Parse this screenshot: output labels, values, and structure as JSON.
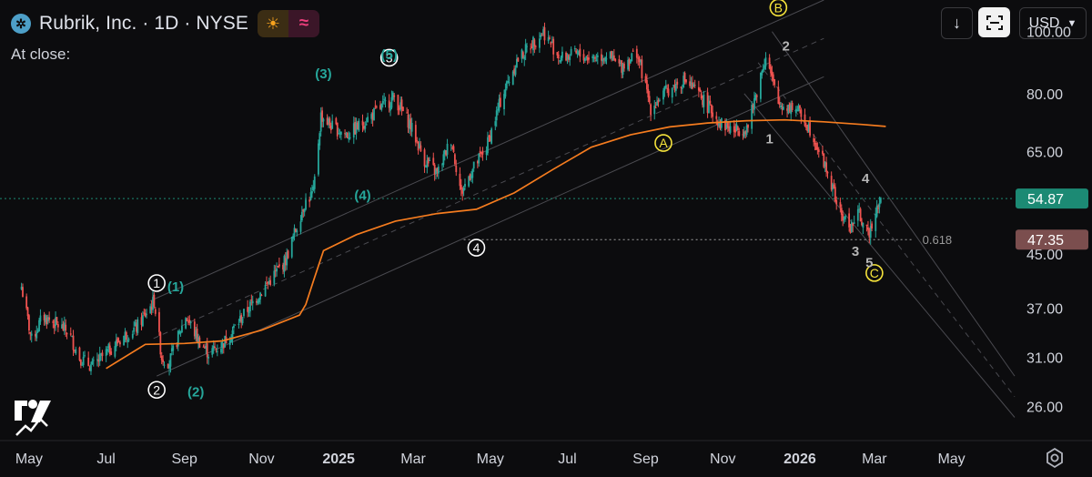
{
  "header": {
    "symbol_title": "Rubrik, Inc. · 1D · NYSE",
    "at_close_label": "At close:",
    "logo_icon": "rubrik-logo-icon",
    "session_icon": "sun-icon",
    "indicator_icon": "wave-icon"
  },
  "toolbar": {
    "currency_label": "USD",
    "download_icon": "arrow-down-icon",
    "screenshot_icon": "frame-icon"
  },
  "settings_icon": "gear-icon",
  "colors": {
    "up": "#26a69a",
    "down": "#ef5350",
    "ma": "#f57c1f",
    "last_price_bg": "#1c8a74",
    "retracement_bg": "#7b4e4e",
    "wave_major": "#ffffff",
    "wave_minor": "#26a69a",
    "wave_abc": "#f5e33b",
    "wave_sub": "#b5b5b5"
  },
  "chart_data": {
    "type": "candlestick",
    "interval": "1D",
    "exchange": "NYSE",
    "y_scale": "log",
    "ylim": [
      23,
      112
    ],
    "y_ticks": [
      26,
      31,
      37,
      45,
      55,
      65,
      80,
      100
    ],
    "y_tick_labels": [
      "26.00",
      "31.00",
      "37.00",
      "45.00",
      "55.00",
      "65.00",
      "80.00",
      "100.00"
    ],
    "x_range": [
      "2024-04-08",
      "2026-06-20"
    ],
    "x_ticks": [
      {
        "date": "2024-05-01",
        "label": "May",
        "bold": false
      },
      {
        "date": "2024-07-01",
        "label": "Jul",
        "bold": false
      },
      {
        "date": "2024-09-01",
        "label": "Sep",
        "bold": false
      },
      {
        "date": "2024-11-01",
        "label": "Nov",
        "bold": false
      },
      {
        "date": "2025-01-01",
        "label": "2025",
        "bold": true
      },
      {
        "date": "2025-03-01",
        "label": "Mar",
        "bold": false
      },
      {
        "date": "2025-05-01",
        "label": "May",
        "bold": false
      },
      {
        "date": "2025-07-01",
        "label": "Jul",
        "bold": false
      },
      {
        "date": "2025-09-01",
        "label": "Sep",
        "bold": false
      },
      {
        "date": "2025-11-01",
        "label": "Nov",
        "bold": false
      },
      {
        "date": "2026-01-01",
        "label": "2026",
        "bold": true
      },
      {
        "date": "2026-03-01",
        "label": "Mar",
        "bold": false
      },
      {
        "date": "2026-05-01",
        "label": "May",
        "bold": false
      }
    ],
    "price_path": [
      [
        "2024-04-25",
        40.0
      ],
      [
        "2024-05-03",
        33.0
      ],
      [
        "2024-05-12",
        36.0
      ],
      [
        "2024-05-22",
        35.0
      ],
      [
        "2024-06-01",
        34.0
      ],
      [
        "2024-06-10",
        31.0
      ],
      [
        "2024-06-20",
        30.0
      ],
      [
        "2024-07-01",
        31.5
      ],
      [
        "2024-07-15",
        33.5
      ],
      [
        "2024-07-25",
        34.5
      ],
      [
        "2024-08-08",
        38.0
      ],
      [
        "2024-08-14",
        31.0
      ],
      [
        "2024-08-20",
        30.5
      ],
      [
        "2024-09-02",
        36.0
      ],
      [
        "2024-09-12",
        33.0
      ],
      [
        "2024-09-20",
        31.5
      ],
      [
        "2024-10-01",
        32.5
      ],
      [
        "2024-10-15",
        35.5
      ],
      [
        "2024-10-28",
        38.5
      ],
      [
        "2024-11-08",
        41.0
      ],
      [
        "2024-11-20",
        44.0
      ],
      [
        "2024-12-05",
        54.0
      ],
      [
        "2024-12-12",
        56.0
      ],
      [
        "2024-12-18",
        74.0
      ],
      [
        "2024-12-27",
        71.0
      ],
      [
        "2025-01-08",
        69.0
      ],
      [
        "2025-01-20",
        72.0
      ],
      [
        "2025-02-03",
        76.0
      ],
      [
        "2025-02-14",
        79.0
      ],
      [
        "2025-02-26",
        72.0
      ],
      [
        "2025-03-10",
        63.0
      ],
      [
        "2025-03-20",
        60.0
      ],
      [
        "2025-03-31",
        68.0
      ],
      [
        "2025-04-08",
        56.0
      ],
      [
        "2025-04-15",
        60.0
      ],
      [
        "2025-04-28",
        66.0
      ],
      [
        "2025-05-10",
        79.0
      ],
      [
        "2025-05-22",
        90.0
      ],
      [
        "2025-06-03",
        96.0
      ],
      [
        "2025-06-12",
        100.0
      ],
      [
        "2025-06-25",
        91.0
      ],
      [
        "2025-07-08",
        92.0
      ],
      [
        "2025-07-20",
        91.0
      ],
      [
        "2025-08-01",
        92.0
      ],
      [
        "2025-08-12",
        88.0
      ],
      [
        "2025-08-25",
        93.0
      ],
      [
        "2025-09-05",
        76.0
      ],
      [
        "2025-09-18",
        81.0
      ],
      [
        "2025-10-02",
        84.0
      ],
      [
        "2025-10-15",
        79.0
      ],
      [
        "2025-10-30",
        72.0
      ],
      [
        "2025-11-10",
        70.0
      ],
      [
        "2025-11-21",
        71.0
      ],
      [
        "2025-12-05",
        92.0
      ],
      [
        "2025-12-15",
        77.0
      ],
      [
        "2025-12-29",
        76.0
      ],
      [
        "2026-01-10",
        70.0
      ],
      [
        "2026-01-22",
        61.0
      ],
      [
        "2026-02-02",
        52.0
      ],
      [
        "2026-02-10",
        49.5
      ],
      [
        "2026-02-17",
        52.0
      ],
      [
        "2026-02-24",
        48.0
      ],
      [
        "2026-03-02",
        53.0
      ],
      [
        "2026-03-06",
        54.87
      ]
    ],
    "moving_average": [
      [
        "2024-07-01",
        29.8
      ],
      [
        "2024-08-01",
        32.5
      ],
      [
        "2024-09-01",
        32.6
      ],
      [
        "2024-10-01",
        32.9
      ],
      [
        "2024-11-01",
        34.2
      ],
      [
        "2024-12-01",
        36.1
      ],
      [
        "2024-12-06",
        37.5
      ],
      [
        "2024-12-12",
        40.8
      ],
      [
        "2024-12-20",
        45.5
      ],
      [
        "2025-01-15",
        48.2
      ],
      [
        "2025-02-15",
        50.6
      ],
      [
        "2025-03-20",
        52.0
      ],
      [
        "2025-04-20",
        52.8
      ],
      [
        "2025-05-20",
        56.0
      ],
      [
        "2025-06-20",
        61.0
      ],
      [
        "2025-07-20",
        66.0
      ],
      [
        "2025-08-20",
        69.0
      ],
      [
        "2025-09-20",
        71.0
      ],
      [
        "2025-10-20",
        72.0
      ],
      [
        "2025-11-20",
        72.6
      ],
      [
        "2025-12-20",
        72.8
      ],
      [
        "2026-01-20",
        72.3
      ],
      [
        "2026-02-20",
        71.6
      ],
      [
        "2026-03-10",
        71.1
      ]
    ],
    "last_price": {
      "value": 54.87,
      "label": "54.87"
    },
    "retracement_level": {
      "value": 47.35,
      "label": "47.35",
      "ratio_label": "0.618"
    },
    "channels": [
      {
        "name": "channel-1",
        "lines": [
          [
            [
              "2024-08-05",
              38.0
            ],
            [
              "2026-01-20",
              112.0
            ]
          ],
          [
            [
              "2024-08-10",
              29.0
            ],
            [
              "2026-01-20",
              85.0
            ]
          ]
        ]
      },
      {
        "name": "channel-2",
        "lines": [
          [
            [
              "2025-11-18",
              80.0
            ],
            [
              "2026-06-20",
              25.0
            ]
          ],
          [
            [
              "2025-12-10",
              100.0
            ],
            [
              "2026-06-20",
              29.0
            ]
          ]
        ]
      }
    ],
    "wave_labels": [
      {
        "text": "1",
        "style": "circle-white",
        "date": "2024-08-10",
        "price": 40.5
      },
      {
        "text": "2",
        "style": "circle-white",
        "date": "2024-08-10",
        "price": 27.6
      },
      {
        "text": "3",
        "style": "circle-white",
        "date": "2025-02-10",
        "price": 91.0
      },
      {
        "text": "4",
        "style": "circle-white",
        "date": "2025-04-20",
        "price": 46.0
      },
      {
        "text": "5",
        "style": "circle-white",
        "date": "2025-06-07",
        "price": 122.0
      },
      {
        "text": "(1)",
        "style": "teal",
        "date": "2024-08-25",
        "price": 40.0
      },
      {
        "text": "(2)",
        "style": "teal",
        "date": "2024-09-10",
        "price": 27.4
      },
      {
        "text": "(3)",
        "style": "teal",
        "date": "2024-12-20",
        "price": 86.0
      },
      {
        "text": "(4)",
        "style": "teal",
        "date": "2025-01-20",
        "price": 55.5
      },
      {
        "text": "(5)",
        "style": "teal",
        "date": "2025-02-10",
        "price": 92.0
      },
      {
        "text": "A",
        "style": "circle-yellow",
        "date": "2025-09-15",
        "price": 67.0
      },
      {
        "text": "B",
        "style": "circle-yellow",
        "date": "2025-12-15",
        "price": 109.0
      },
      {
        "text": "C",
        "style": "circle-yellow",
        "date": "2026-03-01",
        "price": 42.0
      },
      {
        "text": "1",
        "style": "grey",
        "date": "2025-12-08",
        "price": 68.0
      },
      {
        "text": "2",
        "style": "grey",
        "date": "2025-12-21",
        "price": 95.0
      },
      {
        "text": "3",
        "style": "grey",
        "date": "2026-02-14",
        "price": 45.4
      },
      {
        "text": "4",
        "style": "grey",
        "date": "2026-02-22",
        "price": 59.0
      },
      {
        "text": "5",
        "style": "grey",
        "date": "2026-02-25",
        "price": 43.6
      }
    ]
  }
}
